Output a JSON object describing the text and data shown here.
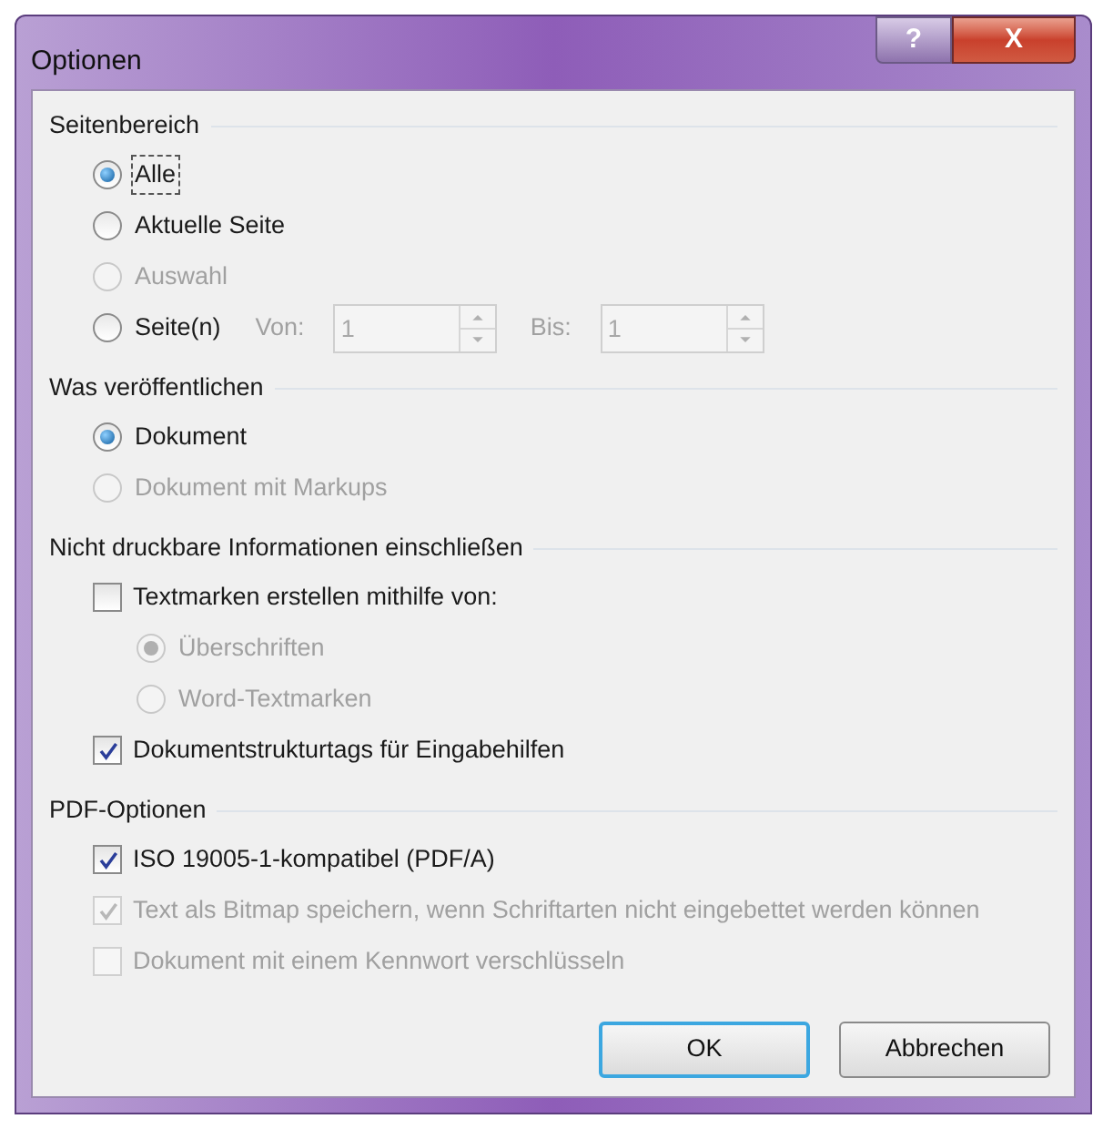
{
  "window": {
    "title": "Optionen",
    "help_button": "?",
    "close_button": "X"
  },
  "sections": [
    {
      "title": "Seitenbereich",
      "items": [
        {
          "kind": "radio",
          "label": "Alle",
          "selected": true,
          "disabled": false,
          "focused": true
        },
        {
          "kind": "radio",
          "label": "Aktuelle Seite",
          "selected": false,
          "disabled": false,
          "focused": false
        },
        {
          "kind": "radio",
          "label": "Auswahl",
          "selected": false,
          "disabled": true,
          "focused": false
        },
        {
          "kind": "radio",
          "label": "Seite(n)",
          "selected": false,
          "disabled": false,
          "focused": false,
          "fields": [
            {
              "label": "Von:",
              "value": "1",
              "disabled": true
            },
            {
              "label": "Bis:",
              "value": "1",
              "disabled": true
            }
          ]
        }
      ]
    },
    {
      "title": "Was veröffentlichen",
      "items": [
        {
          "kind": "radio",
          "label": "Dokument",
          "selected": true,
          "disabled": false,
          "focused": false
        },
        {
          "kind": "radio",
          "label": "Dokument mit Markups",
          "selected": false,
          "disabled": true,
          "focused": false
        }
      ]
    },
    {
      "title": "Nicht druckbare Informationen einschließen",
      "items": [
        {
          "kind": "checkbox",
          "label": "Textmarken erstellen mithilfe von:",
          "checked": false,
          "disabled": false,
          "focused": false,
          "children": [
            {
              "kind": "radio",
              "label": "Überschriften",
              "selected": true,
              "disabled": true,
              "focused": false
            },
            {
              "kind": "radio",
              "label": "Word-Textmarken",
              "selected": false,
              "disabled": true,
              "focused": false
            }
          ]
        },
        {
          "kind": "checkbox",
          "label": "Dokumentstrukturtags für Eingabehilfen",
          "checked": true,
          "disabled": false,
          "focused": false
        }
      ]
    },
    {
      "title": "PDF-Optionen",
      "items": [
        {
          "kind": "checkbox",
          "label": "ISO 19005-1-kompatibel (PDF/A)",
          "checked": true,
          "disabled": false,
          "focused": false
        },
        {
          "kind": "checkbox",
          "label": "Text als Bitmap speichern, wenn Schriftarten nicht eingebettet werden können",
          "checked": true,
          "disabled": true,
          "focused": false
        },
        {
          "kind": "checkbox",
          "label": "Dokument mit einem Kennwort verschlüsseln",
          "checked": false,
          "disabled": true,
          "focused": false
        }
      ]
    }
  ],
  "buttons": [
    {
      "label": "OK",
      "default": true
    },
    {
      "label": "Abbrechen",
      "default": false
    }
  ]
}
